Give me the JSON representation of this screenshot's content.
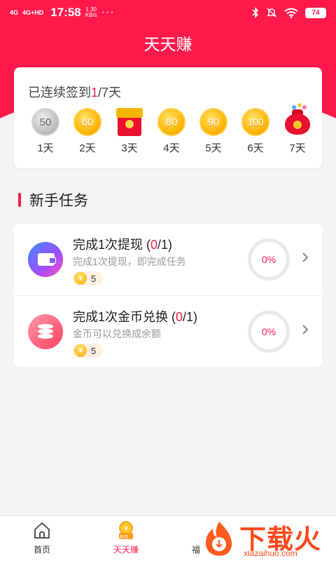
{
  "status_bar": {
    "signal_1": "4G",
    "signal_2": "4G+HD",
    "time": "17:58",
    "speed_value": "1.30",
    "speed_unit": "KB/s",
    "more": "···",
    "battery": "74"
  },
  "header": {
    "title": "天天赚"
  },
  "checkin": {
    "text_prefix": "已连续签到",
    "current": "1",
    "text_suffix": "/7天",
    "days": [
      {
        "value": "50",
        "label": "1天",
        "kind": "silver"
      },
      {
        "value": "60",
        "label": "2天",
        "kind": "gold"
      },
      {
        "value": "",
        "label": "3天",
        "kind": "red-packet"
      },
      {
        "value": "80",
        "label": "4天",
        "kind": "gold"
      },
      {
        "value": "90",
        "label": "5天",
        "kind": "gold"
      },
      {
        "value": "100",
        "label": "6天",
        "kind": "gold"
      },
      {
        "value": "",
        "label": "7天",
        "kind": "lucky-bag"
      }
    ]
  },
  "newbie": {
    "title": "新手任务",
    "tasks": [
      {
        "title_prefix": "完成1次提现 (",
        "done": "0",
        "title_suffix": "/1)",
        "desc": "完成1次提现，即完成任务",
        "reward_symbol": "¥",
        "reward": "5",
        "progress": "0%",
        "icon": "wallet-icon"
      },
      {
        "title_prefix": "完成1次金币兑换 (",
        "done": "0",
        "title_suffix": "/1)",
        "desc": "金币可以兑换成余额",
        "reward_symbol": "¥",
        "reward": "5",
        "progress": "0%",
        "icon": "coin-stack-icon"
      }
    ]
  },
  "tabbar": {
    "tabs": [
      {
        "label": "首页",
        "icon": "home-icon"
      },
      {
        "label": "天天赚",
        "icon": "checkin-coin-icon",
        "badge": "签到",
        "active": true
      },
      {
        "label": "福",
        "icon": "gift-icon"
      }
    ]
  },
  "watermark": {
    "brand": "下载火",
    "url": "xiazaihuo.com"
  },
  "colors": {
    "accent": "#ff1a4b",
    "gold": "#ffb300",
    "background": "#f4f4f4"
  }
}
